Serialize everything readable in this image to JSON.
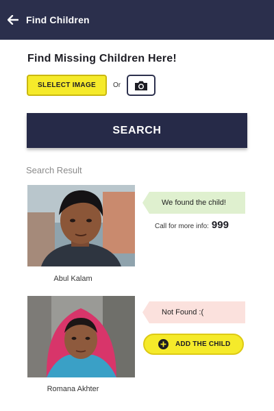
{
  "app_bar": {
    "title": "Find Children",
    "back_icon": "arrow-left-icon"
  },
  "main": {
    "headline": "Find Missing Children Here!",
    "select_button_label": "SLELECT IMAGE",
    "or_label": "Or",
    "camera_icon": "camera-icon",
    "search_button_label": "SEARCH"
  },
  "results": {
    "section_label": "Search Result",
    "items": [
      {
        "name": "Abul Kalam",
        "status": "We found the child!",
        "info_label": "Call for more info:",
        "info_number": "999"
      },
      {
        "name": "Romana Akhter",
        "status": "Not Found :(",
        "action_label": "ADD THE CHILD",
        "action_icon": "plus-circle-icon"
      }
    ]
  },
  "colors": {
    "app_bar": "#2b2f4c",
    "accent_yellow": "#f5ea2a",
    "found_tag": "#dff0cf",
    "notfound_tag": "#fbe1dd"
  }
}
